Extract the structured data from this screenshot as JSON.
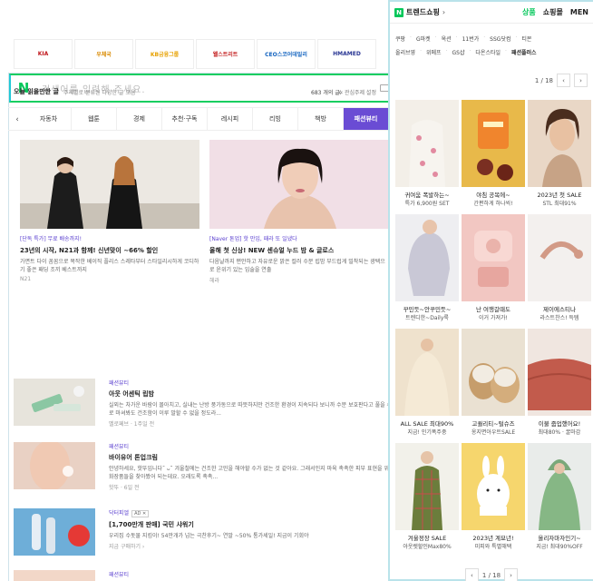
{
  "colors": {
    "naver_green": "#03c75a",
    "accent_purple": "#6a4cd4"
  },
  "back_window": {
    "search_placeholder": "검색어를 입력해 주세요.",
    "logo": "N",
    "brands": [
      {
        "label": "KIA",
        "color": "#c0161b"
      },
      {
        "label": "우체국",
        "color": "#d98a00"
      },
      {
        "label": "KB금융그룹",
        "color": "#e7a100"
      },
      {
        "label": "웰스트리트",
        "color": "#c62828"
      },
      {
        "label": "CEO스코어데일리",
        "color": "#1565c0"
      },
      {
        "label": "HMAMED",
        "color": "#283593"
      }
    ],
    "today": {
      "title": "오늘 읽을만한 글",
      "subtitle": "주제별로 분류된 다양한 글 모음",
      "count": "683 개의 글",
      "settings": "✲ 관심주제 설정"
    },
    "category_prev": "‹",
    "categories": [
      {
        "label": "자동차"
      },
      {
        "label": "웹툰"
      },
      {
        "label": "경제"
      },
      {
        "label": "추천·구독"
      },
      {
        "label": "레시피"
      },
      {
        "label": "리빙"
      },
      {
        "label": "책방"
      },
      {
        "label": "패션뷰티"
      }
    ],
    "features": [
      {
        "tag": "[단독 특가] 무료 배송까지!",
        "title": "23년의 시작, N21과 함께! 신년맞이 ~66% 할인",
        "desc": "가면트 다이 꼼꼼으로 복작한 베이직 플리스 스레타부터 스타일리시하게 코디하기 좋은 패딩 조끼 베스트까지",
        "source": "N21"
      },
      {
        "tag": "[Naver 톤업] 핫 만입, 패라 또 일냈다",
        "title": "올해 첫 신상! NEW 센슈얼 누드 밤 & 글로스",
        "desc": "다음날까지 편안하고 자유로운 밝은 컬러 수분 립밤 부드럽게 밀착되는 광택으로 윤위기 있는 입술을 연출",
        "source": "헤라"
      }
    ],
    "articles": [
      {
        "category": "패션뷰티",
        "title": "아웃 어센틱 립밤",
        "desc": "실외는 차가운 바람이 몰아치고, 실내는 난방 풍가동으로 따뜻하지만 건조한 환경이 지속되다 보니까 수분 보호판다고 풀을 수시로 마셔봐도 건조함이 이루 말할 수 없을 정도라...",
        "meta": "멜로페브 · 1주일 전"
      },
      {
        "category": "패션뷰티",
        "title": "바이유어 톤업크림",
        "desc": "안녕하세요, 핫뚜입니다˘ ᴗ˘ 겨울철에는 건조한 고민을 해야할 수가 없는 것 같아요. 그래서인지 마육 촉촉한 피부 표현을 위한 화장품들을 찾아봤어 되는데요. 오래도록 촉촉...",
        "meta": "핫뚜 · 6일 전"
      },
      {
        "category": "닥터피엘",
        "ad": "AD ✕",
        "title": "[1,700만개 판매] 국민 샤워기",
        "desc": "우리집 수돗물 지킴이! 54만개가 넘는 극찬후기~ 연말 ~50% 통가세일! 지금이 기회야",
        "meta": "지금 구매하기 ›"
      },
      {
        "category": "패션뷰티",
        "title": "",
        "desc": "",
        "meta": ""
      }
    ]
  },
  "front_panel": {
    "badge": "N",
    "title": "트렌드쇼핑",
    "title_chevron": "›",
    "tabs": [
      {
        "label": "상품"
      },
      {
        "label": "쇼핑몰"
      },
      {
        "label": "MEN"
      }
    ],
    "shops_row1": [
      "쿠팡",
      "G마켓",
      "옥션",
      "11번가",
      "SSG닷컴",
      "티몬"
    ],
    "shops_row2": [
      "올리브영",
      "위메프",
      "GS샵",
      "다온스타일",
      "패션플러스"
    ],
    "pager_top": {
      "text": "1 / 18",
      "prev": "‹",
      "next": "›"
    },
    "pager_bottom": {
      "text": "1 / 18",
      "prev": "‹",
      "next": "›"
    },
    "products": [
      {
        "line1": "귀여움 폭발하는~",
        "line2": "특가 6,900원 SET",
        "icon": "clothing-icon"
      },
      {
        "line1": "야침 공복에~",
        "line2": "간편하게 하나씩!",
        "icon": "snack-icon"
      },
      {
        "line1": "2023년 첫 SALE",
        "line2": "STL 최대91%",
        "icon": "model-icon"
      },
      {
        "line1": "꾸민듯~안꾸민듯~",
        "line2": "트렌디한~Daily룩",
        "icon": "knit-icon"
      },
      {
        "line1": "난 여행갈때도",
        "line2": "이거 가져가!",
        "icon": "humidifier-icon"
      },
      {
        "line1": "제이에스티나",
        "line2": "라스트찬스! 득템",
        "icon": "bracelet-icon"
      },
      {
        "line1": "ALL SALE 최대90%",
        "line2": "지금! 인기폭주중",
        "icon": "fleece-icon"
      },
      {
        "line1": "고퀄리티~털슈즈",
        "line2": "옹지면아우트SALE",
        "icon": "slipper-icon"
      },
      {
        "line1": "이불 줍업했어요!",
        "line2": "최대80% · 꿀마감",
        "icon": "blanket-icon"
      },
      {
        "line1": "겨울정장 SALE",
        "line2": "아웃렛할인Max80%",
        "icon": "plaid-dress-icon"
      },
      {
        "line1": "2023년 계묘년!",
        "line2": "미피와 특별해택",
        "icon": "miffy-icon"
      },
      {
        "line1": "올리자마자인기~",
        "line2": "지금! 최대90%OFF",
        "icon": "hoodie-icon"
      }
    ]
  }
}
